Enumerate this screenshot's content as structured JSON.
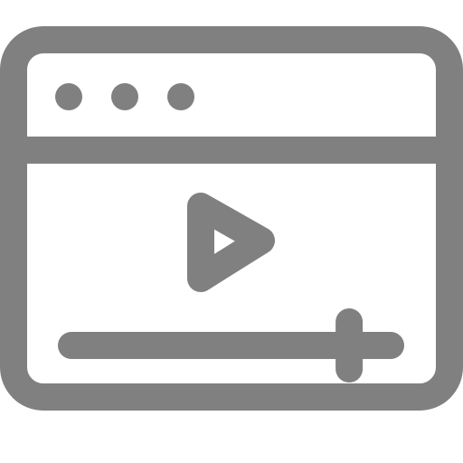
{
  "icon": {
    "name": "video-player-window-icon",
    "color": "#808080",
    "window_control_dots": 3,
    "progress": 0.87
  }
}
